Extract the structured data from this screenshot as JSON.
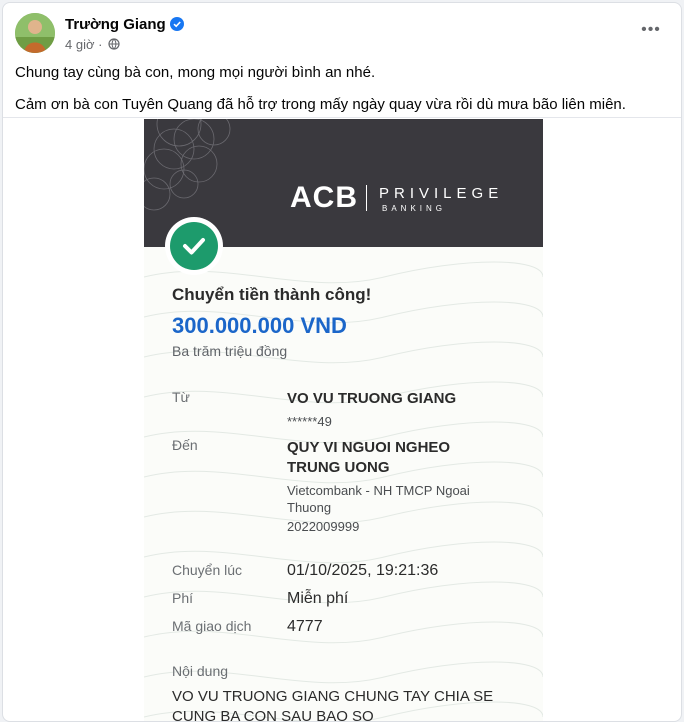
{
  "post": {
    "author": "Trường Giang",
    "time": "4 giờ",
    "separator": "·",
    "more_label": "•••",
    "text_lines": [
      "Chung tay cùng bà con, mong mọi người bình an nhé.",
      "Cảm ơn bà con Tuyên Quang đã hỗ trợ trong mấy ngày quay vừa rồi dù mưa bão liên miên."
    ]
  },
  "receipt": {
    "logo": "ACB",
    "brand_top": "PRIVILEGE",
    "brand_bottom": "BANKING",
    "status": "Chuyển tiền thành công!",
    "amount": "300.000.000 VND",
    "amount_words": "Ba trăm triệu đồng",
    "from_label": "Từ",
    "from_name": "VO VU TRUONG GIANG",
    "from_account": "******49",
    "to_label": "Đến",
    "to_name_line1": "QUY VI NGUOI NGHEO",
    "to_name_line2": "TRUNG UONG",
    "to_bank_line1": "Vietcombank - NH TMCP Ngoai",
    "to_bank_line2": "Thuong",
    "to_account": "2022009999",
    "time_label": "Chuyển lúc",
    "time_value": "01/10/2025, 19:21:36",
    "fee_label": "Phí",
    "fee_value": "Miễn phí",
    "txn_label": "Mã giao dịch",
    "txn_value": "4777",
    "content_label": "Nội dung",
    "content_line1": "VO VU TRUONG GIANG CHUNG TAY CHIA SE",
    "content_line2": "CUNG BA CON SAU BAO SO"
  },
  "colors": {
    "facebook_blue": "#1877f2",
    "banner": "#3a393e",
    "success_green": "#1d9b6c",
    "amount_blue": "#1b66c9"
  },
  "icons": [
    "verified-badge-icon",
    "globe-icon",
    "more-options-icon",
    "success-check-icon"
  ]
}
